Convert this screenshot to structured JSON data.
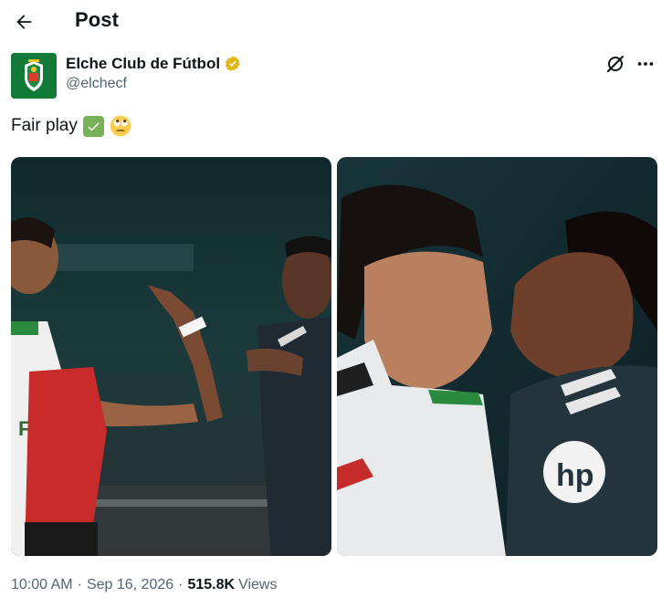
{
  "header": {
    "title": "Post"
  },
  "author": {
    "name": "Elche Club de Fútbol",
    "handle": "@elchecf"
  },
  "post": {
    "text": "Fair play",
    "emojis": [
      "check-mark-emoji",
      "face-with-rolling-eyes-emoji"
    ]
  },
  "media": [
    {
      "name": "photo-1",
      "description_icon": "football-players-confrontation"
    },
    {
      "name": "photo-2",
      "description_icon": "football-players-face-off"
    }
  ],
  "meta": {
    "time": "10:00 AM",
    "date": "Sep 16, 2026",
    "views_count": "515.8K",
    "views_label": "Views"
  },
  "colors": {
    "text": "#0f1419",
    "secondary": "#536471",
    "verified": "#e2b719",
    "elche_green": "#127a38"
  }
}
